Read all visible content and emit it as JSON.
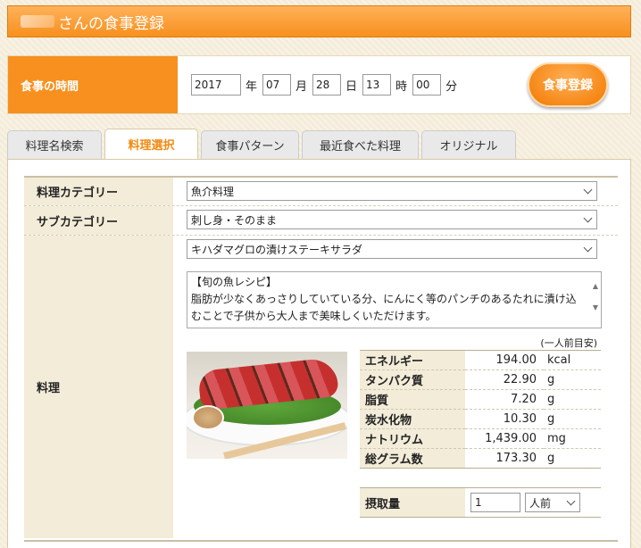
{
  "header": {
    "title_suffix": "さんの食事登録"
  },
  "meal_time": {
    "label": "食事の時間",
    "year": "2017",
    "year_unit": "年",
    "month": "07",
    "month_unit": "月",
    "day": "28",
    "day_unit": "日",
    "hour": "13",
    "hour_unit": "時",
    "minute": "00",
    "minute_unit": "分",
    "register_label": "食事登録"
  },
  "tabs": [
    {
      "label": "料理名検索"
    },
    {
      "label": "料理選択"
    },
    {
      "label": "食事パターン"
    },
    {
      "label": "最近食べた料理"
    },
    {
      "label": "オリジナル"
    }
  ],
  "form": {
    "category_label": "料理カテゴリー",
    "category_value": "魚介料理",
    "subcategory_label": "サブカテゴリー",
    "subcategory_value": "刺し身・そのまま",
    "dish_label": "料理",
    "dish_value": "キハダマグロの漬けステーキサラダ",
    "description_title": "【旬の魚レシピ】",
    "description_body": "脂肪が少なくあっさりしていている分、にんにく等のパンチのあるたれに漬け込むことで子供から大人まで美味しくいただけます。",
    "per_person_note": "(一人前目安)"
  },
  "nutrition": [
    {
      "label": "エネルギー",
      "value": "194.00",
      "unit": "kcal"
    },
    {
      "label": "タンパク質",
      "value": "22.90",
      "unit": "g"
    },
    {
      "label": "脂質",
      "value": "7.20",
      "unit": "g"
    },
    {
      "label": "炭水化物",
      "value": "10.30",
      "unit": "g"
    },
    {
      "label": "ナトリウム",
      "value": "1,439.00",
      "unit": "mg"
    },
    {
      "label": "総グラム数",
      "value": "173.30",
      "unit": "g"
    }
  ],
  "intake": {
    "label": "摂取量",
    "amount": "1",
    "unit": "人前"
  },
  "colors": {
    "accent": "#f7901e",
    "label_bg": "#f2ecd8",
    "active_tab_text": "#f08a10"
  }
}
